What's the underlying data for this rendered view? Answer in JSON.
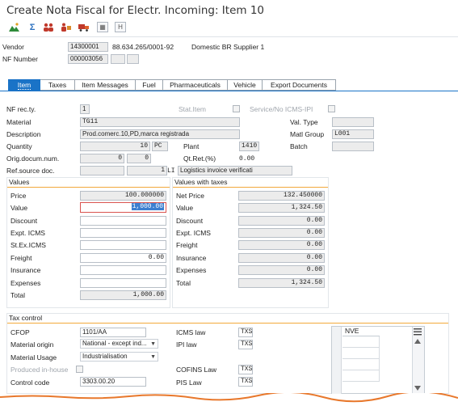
{
  "window": {
    "title": "Create Nota Fiscal for Electr. Incoming: Item 10"
  },
  "toolbar": {
    "icons": [
      "mountain-chart-icon",
      "sigma-icon",
      "people-icon",
      "delivery-icon",
      "truck-icon",
      "grid-icon",
      "bracket-h-icon"
    ],
    "sigma": "Σ",
    "grid": "▦",
    "h": "H"
  },
  "header": {
    "vendor_label": "Vendor",
    "vendor_code": "14300001",
    "vendor_tax": "88.634.265/0001-92",
    "vendor_name": "Domestic BR Supplier 1",
    "nf_label": "NF Number",
    "nf_value": "000003056"
  },
  "tabs": [
    {
      "label": "Item",
      "active": true
    },
    {
      "label": "Taxes"
    },
    {
      "label": "Item Messages"
    },
    {
      "label": "Fuel"
    },
    {
      "label": "Pharmaceuticals"
    },
    {
      "label": "Vehicle"
    },
    {
      "label": "Export Documents"
    }
  ],
  "item": {
    "nf_rec_ty_label": "NF rec.ty.",
    "nf_rec_ty": "1",
    "stat_item_label": "Stat.Item",
    "service_label": "Service/No ICMS-IPI",
    "material_label": "Material",
    "material": "TG11",
    "val_type_label": "Val. Type",
    "description_label": "Description",
    "description": "Prod.comerc.10,PD,marca registrada",
    "matl_group_label": "Matl Group",
    "matl_group": "L001",
    "quantity_label": "Quantity",
    "quantity": "10",
    "uom": "PC",
    "plant_label": "Plant",
    "plant": "1410",
    "batch_label": "Batch",
    "orig_doc_label": "Orig.docum.num.",
    "orig_doc_1": "0",
    "orig_doc_2": "0",
    "qt_ret_label": "Qt.Ret.(%)",
    "qt_ret": "0.00",
    "ref_source_label": "Ref.source doc.",
    "ref_source_num": "1",
    "ref_source_type": "LI",
    "ref_source_text": "Logistics invoice verificati"
  },
  "values": {
    "title": "Values",
    "price_label": "Price",
    "price": "100.000000",
    "value_label": "Value",
    "value": "1,000.00",
    "discount_label": "Discount",
    "expt_icms_label": "Expt. ICMS",
    "stex_icms_label": "St.Ex.ICMS",
    "freight_label": "Freight",
    "freight": "0.00",
    "insurance_label": "Insurance",
    "expenses_label": "Expenses",
    "total_label": "Total",
    "total": "1,000.00"
  },
  "values_taxes": {
    "title": "Values with taxes",
    "net_price_label": "Net Price",
    "net_price": "132.450000",
    "value_label": "Value",
    "value": "1,324.50",
    "discount_label": "Discount",
    "discount": "0.00",
    "expt_icms_label": "Expt. ICMS",
    "expt_icms": "0.00",
    "freight_label": "Freight",
    "freight": "0.00",
    "insurance_label": "Insurance",
    "insurance": "0.00",
    "expenses_label": "Expenses",
    "expenses": "0.00",
    "total_label": "Total",
    "total": "1,324.50"
  },
  "tax_control": {
    "title": "Tax control",
    "cfop_label": "CFOP",
    "cfop": "1101/AA",
    "material_origin_label": "Material origin",
    "material_origin": "National - except ind...",
    "material_usage_label": "Material Usage",
    "material_usage": "Industrialisation",
    "produced_label": "Produced in-house",
    "control_code_label": "Control code",
    "control_code": "3303.00.20",
    "icms_law_label": "ICMS law",
    "icms_law": "TXS",
    "ipi_law_label": "IPI law",
    "ipi_law": "TXS",
    "cofins_law_label": "COFINS Law",
    "cofins_law": "TXS",
    "pis_law_label": "PIS Law",
    "pis_law": "TXS",
    "nve_header": "NVE"
  },
  "colors": {
    "accent": "#1a73c7",
    "section_line": "#f2a93b",
    "wave": "#e8782c"
  }
}
